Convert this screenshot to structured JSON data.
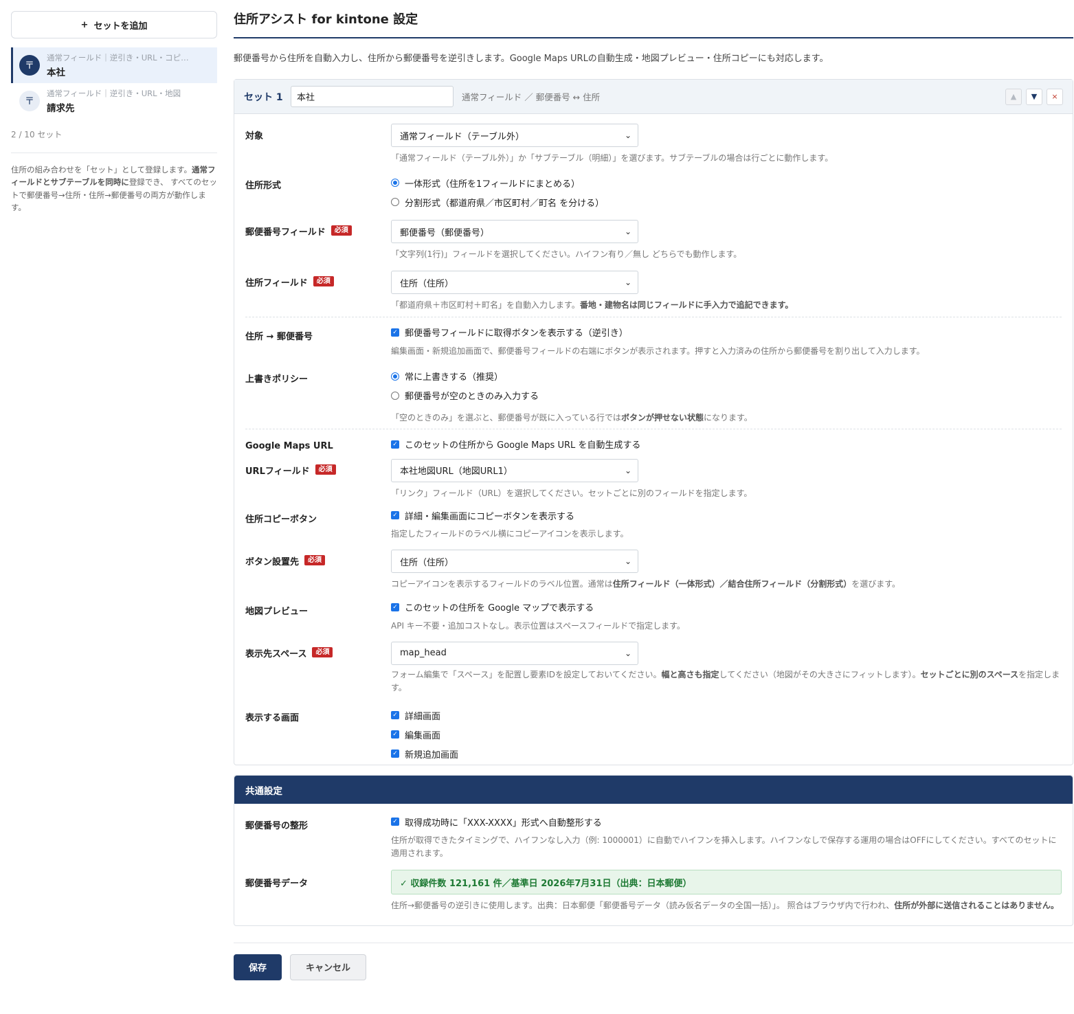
{
  "sidebar": {
    "add_button": "セットを追加",
    "add_icon": "+",
    "sets": [
      {
        "meta": "通常フィールド｜逆引き・URL・コピー…",
        "name": "本社",
        "icon": "〒"
      },
      {
        "meta": "通常フィールド｜逆引き・URL・地図",
        "name": "請求先",
        "icon": "〒"
      }
    ],
    "count": "2 / 10 セット",
    "help_parts": [
      "住所の組み合わせを「セット」として登録します。",
      "通常フィールドとサブテーブルを同時に",
      "登録でき、 すべてのセットで郵便番号→住所・住所→郵便番号の両方が動作します。"
    ]
  },
  "page": {
    "title": "住所アシスト for kintone 設定",
    "description": "郵便番号から住所を自動入力し、住所から郵便番号を逆引きします。Google Maps URLの自動生成・地図プレビュー・住所コピーにも対応します。"
  },
  "set_card": {
    "label": "セット 1",
    "name_value": "本社",
    "summary": "通常フィールド ／ 郵便番号 ↔ 住所",
    "up_icon": "▲",
    "down_icon": "▼",
    "delete_icon": "×",
    "required": "必須",
    "target": {
      "label": "対象",
      "value": "通常フィールド（テーブル外）",
      "help": "「通常フィールド（テーブル外）」か「サブテーブル（明細）」を選びます。サブテーブルの場合は行ごとに動作します。"
    },
    "address_format": {
      "label": "住所形式",
      "option1": "一体形式（住所を1フィールドにまとめる）",
      "option2": "分割形式（都道府県／市区町村／町名 を分ける）"
    },
    "zip_field": {
      "label": "郵便番号フィールド",
      "value": "郵便番号（郵便番号）",
      "help": "「文字列(1行)」フィールドを選択してください。ハイフン有り／無し どちらでも動作します。"
    },
    "address_field": {
      "label": "住所フィールド",
      "value": "住所（住所）",
      "help_a": "「都道府県＋市区町村＋町名」を自動入力します。",
      "help_b": "番地・建物名は同じフィールドに手入力で追記できます。"
    },
    "reverse": {
      "label": "住所 → 郵便番号",
      "check": "郵便番号フィールドに取得ボタンを表示する（逆引き）",
      "help": "編集画面・新規追加画面で、郵便番号フィールドの右端にボタンが表示されます。押すと入力済みの住所から郵便番号を割り出して入力します。"
    },
    "overwrite": {
      "label": "上書きポリシー",
      "option1": "常に上書きする（推奨）",
      "option2": "郵便番号が空のときのみ入力する",
      "help_a": "「空のときのみ」を選ぶと、郵便番号が既に入っている行では",
      "help_b": "ボタンが押せない状態",
      "help_c": "になります。"
    },
    "maps": {
      "label": "Google Maps URL",
      "check": "このセットの住所から Google Maps URL を自動生成する"
    },
    "url_field": {
      "label": "URLフィールド",
      "value": "本社地図URL（地図URL1）",
      "help": "「リンク」フィールド（URL）を選択してください。セットごとに別のフィールドを指定します。"
    },
    "copy_button": {
      "label": "住所コピーボタン",
      "check": "詳細・編集画面にコピーボタンを表示する",
      "help": "指定したフィールドのラベル横にコピーアイコンを表示します。"
    },
    "button_place": {
      "label": "ボタン設置先",
      "value": "住所（住所）",
      "help_a": "コピーアイコンを表示するフィールドのラベル位置。通常は",
      "help_b": "住所フィールド（一体形式）／結合住所フィールド（分割形式）",
      "help_c": "を選びます。"
    },
    "map_preview": {
      "label": "地図プレビュー",
      "check": "このセットの住所を Google マップで表示する",
      "help": "API キー不要・追加コストなし。表示位置はスペースフィールドで指定します。"
    },
    "space": {
      "label": "表示先スペース",
      "value": "map_head",
      "help_a": "フォーム編集で「スペース」を配置し要素IDを設定しておいてください。",
      "help_b": "幅と高さも指定",
      "help_c": "してください（地図がその大きさにフィットします）。",
      "help_d": "セットごとに別のスペース",
      "help_e": "を指定します。"
    },
    "screens": {
      "label": "表示する画面",
      "opt1": "詳細画面",
      "opt2": "編集画面",
      "opt3": "新規追加画面"
    }
  },
  "common": {
    "title": "共通設定",
    "format": {
      "label": "郵便番号の整形",
      "check": "取得成功時に「XXX-XXXX」形式へ自動整形する",
      "help": "住所が取得できたタイミングで、ハイフンなし入力（例: 1000001）に自動でハイフンを挿入します。ハイフンなしで保存する運用の場合はOFFにしてください。すべてのセットに適用されます。"
    },
    "data": {
      "label": "郵便番号データ",
      "status": "✓ 収録件数 121,161 件／基準日 2026年7月31日（出典：日本郵便）",
      "help_a": "住所→郵便番号の逆引きに使用します。出典：日本郵便「郵便番号データ（読み仮名データの全国一括）」。 照合はブラウザ内で行われ、",
      "help_b": "住所が外部に送信されることはありません。"
    }
  },
  "footer": {
    "save": "保存",
    "cancel": "キャンセル"
  },
  "colors": {
    "accent": "#1f3a68",
    "required": "#c62828",
    "checkbox": "#1a73e8",
    "success": "#1e7a34"
  }
}
